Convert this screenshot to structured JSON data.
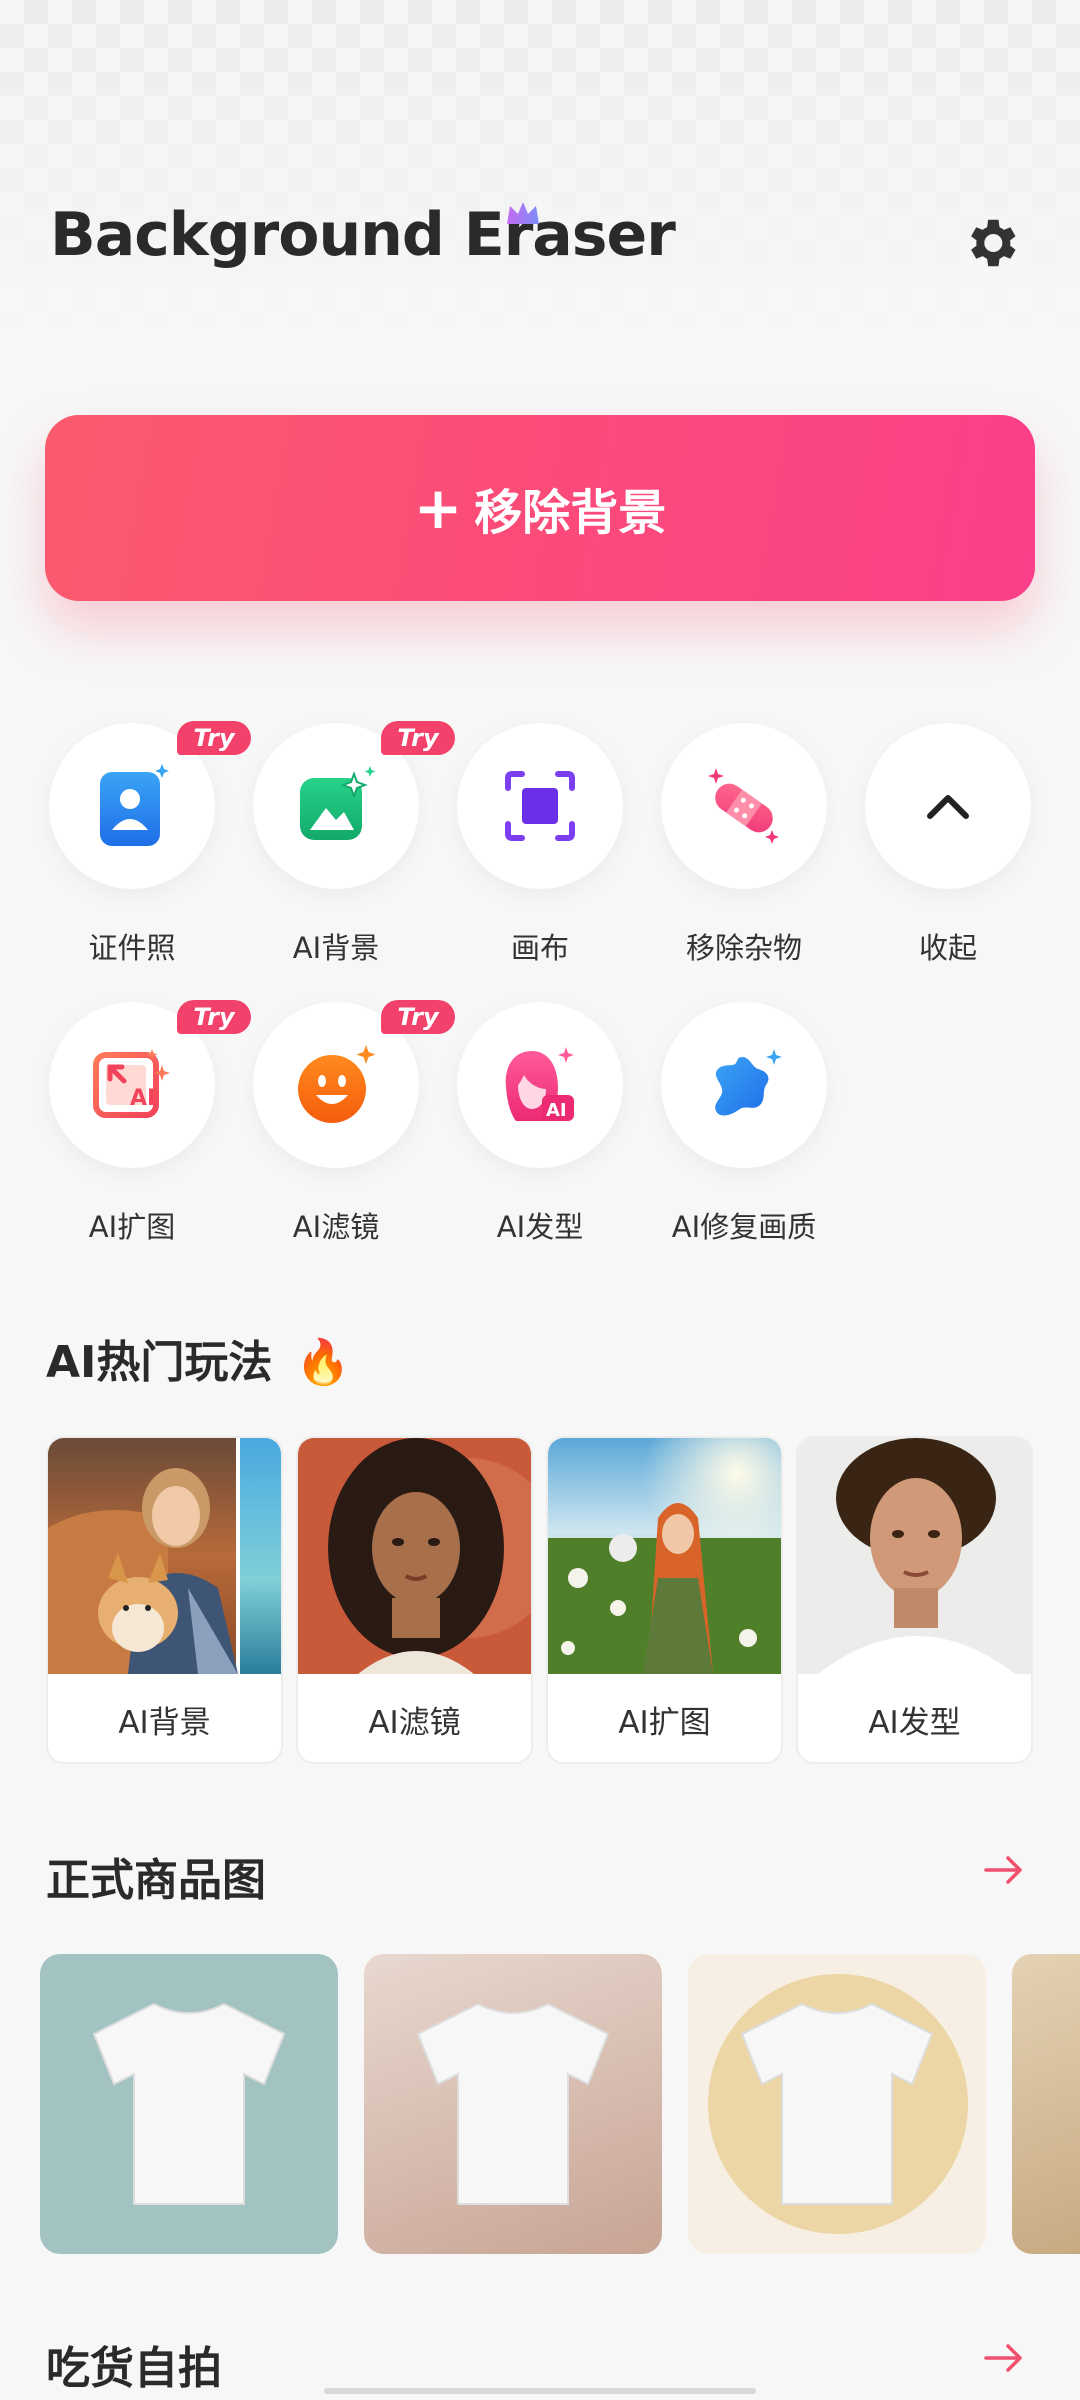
{
  "app": {
    "title": "Background Eraser",
    "settings_icon": "gear-icon"
  },
  "main_action": {
    "icon": "plus-icon",
    "label": "移除背景"
  },
  "tools": [
    {
      "label": "证件照",
      "icon": "id-photo-icon",
      "badge": "Try"
    },
    {
      "label": "AI背景",
      "icon": "ai-background-icon",
      "badge": "Try"
    },
    {
      "label": "画布",
      "icon": "canvas-icon",
      "badge": ""
    },
    {
      "label": "移除杂物",
      "icon": "bandage-remove-icon",
      "badge": ""
    },
    {
      "label": "收起",
      "icon": "chevron-up-icon",
      "badge": ""
    },
    {
      "label": "AI扩图",
      "icon": "ai-expand-icon",
      "badge": "Try"
    },
    {
      "label": "AI滤镜",
      "icon": "ai-filter-smiley-icon",
      "badge": "Try"
    },
    {
      "label": "AI发型",
      "icon": "ai-hairstyle-icon",
      "badge": ""
    },
    {
      "label": "AI修复画质",
      "icon": "ai-enhance-icon",
      "badge": ""
    }
  ],
  "hot_section": {
    "title": "AI热门玩法",
    "emoji": "🔥",
    "cards": [
      {
        "label": "AI背景"
      },
      {
        "label": "AI滤镜"
      },
      {
        "label": "AI扩图"
      },
      {
        "label": "AI发型"
      }
    ]
  },
  "product_section": {
    "title": "正式商品图",
    "arrow_icon": "arrow-right-icon"
  },
  "food_section": {
    "title": "吃货自拍",
    "arrow_icon": "arrow-right-icon"
  },
  "colors": {
    "accent": "#fb4b79",
    "badge": "#f2416a",
    "arrow": "#f0506e"
  }
}
